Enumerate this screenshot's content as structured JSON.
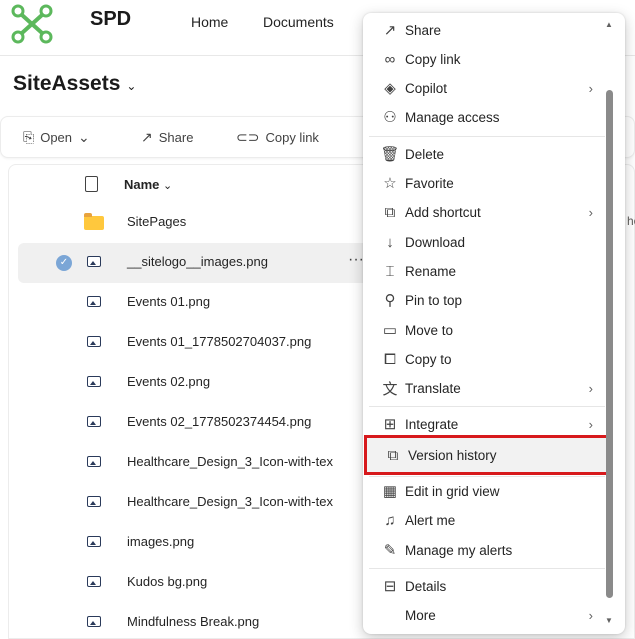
{
  "topbar": {
    "site_name": "SPD",
    "nav": [
      "Home",
      "Documents"
    ]
  },
  "library": {
    "title": "SiteAssets"
  },
  "commands": {
    "open": "Open",
    "share": "Share",
    "copy_link": "Copy link"
  },
  "list": {
    "header": "Name",
    "files": [
      "SitePages",
      "__sitelogo__images.png",
      "Events 01.png",
      "Events 01_1778502704037.png",
      "Events 02.png",
      "Events 02_1778502374454.png",
      "Healthcare_Design_3_Icon-with-tex",
      "Healthcare_Design_3_Icon-with-tex",
      "images.png",
      "Kudos bg.png",
      "Mindfulness Break.png"
    ],
    "more": "···"
  },
  "menu": {
    "items": [
      {
        "label": "Share",
        "icon": "share-icon"
      },
      {
        "label": "Copy link",
        "icon": "link-icon"
      },
      {
        "label": "Copilot",
        "icon": "copilot-icon",
        "sub": true
      },
      {
        "label": "Manage access",
        "icon": "person-icon"
      },
      {
        "label": "Delete",
        "icon": "trash-icon"
      },
      {
        "label": "Favorite",
        "icon": "star-icon"
      },
      {
        "label": "Add shortcut",
        "icon": "shortcut-icon",
        "sub": true
      },
      {
        "label": "Download",
        "icon": "download-icon"
      },
      {
        "label": "Rename",
        "icon": "rename-icon"
      },
      {
        "label": "Pin to top",
        "icon": "pin-icon"
      },
      {
        "label": "Move to",
        "icon": "move-icon"
      },
      {
        "label": "Copy to",
        "icon": "copy-icon"
      },
      {
        "label": "Translate",
        "icon": "translate-icon",
        "sub": true
      },
      {
        "label": "Integrate",
        "icon": "integrate-icon",
        "sub": true
      },
      {
        "label": "Version history",
        "icon": "version-history-icon"
      },
      {
        "label": "Edit in grid view",
        "icon": "grid-icon"
      },
      {
        "label": "Alert me",
        "icon": "bell-icon"
      },
      {
        "label": "Manage my alerts",
        "icon": "alerts-icon"
      },
      {
        "label": "Details",
        "icon": "details-icon"
      },
      {
        "label": "More",
        "icon": "more-icon",
        "sub": true
      }
    ]
  },
  "colors": {
    "highlight_border": "#d7191c",
    "logo_green": "#5cb85c",
    "folder": "#ffc83d"
  }
}
